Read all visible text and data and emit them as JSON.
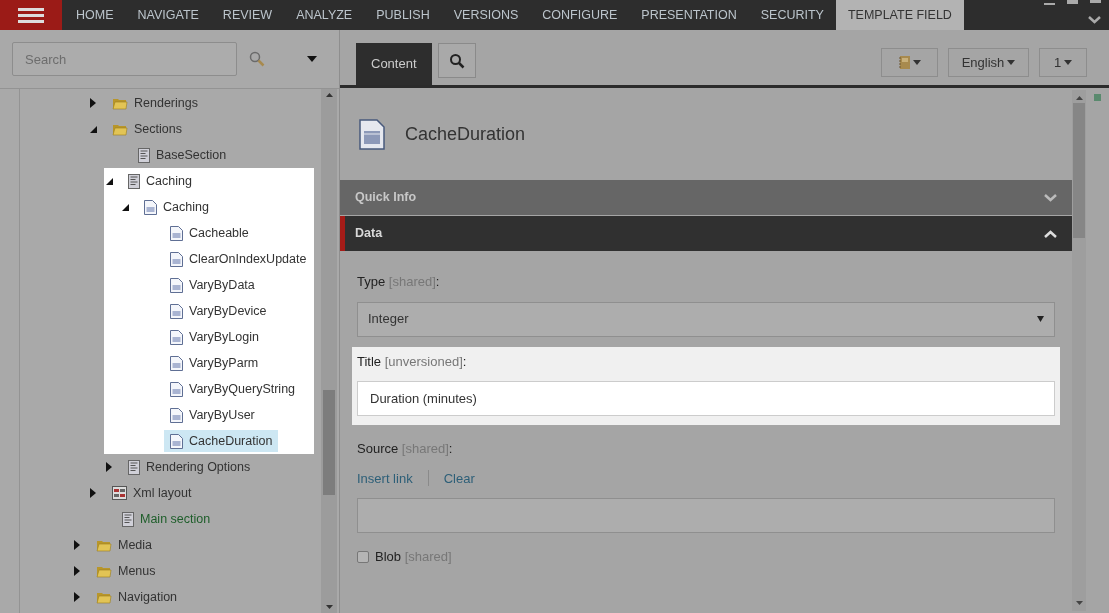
{
  "ribbon": {
    "tabs": [
      {
        "label": "HOME",
        "selected": false
      },
      {
        "label": "NAVIGATE",
        "selected": false
      },
      {
        "label": "REVIEW",
        "selected": false
      },
      {
        "label": "ANALYZE",
        "selected": false
      },
      {
        "label": "PUBLISH",
        "selected": false
      },
      {
        "label": "VERSIONS",
        "selected": false
      },
      {
        "label": "CONFIGURE",
        "selected": false
      },
      {
        "label": "PRESENTATION",
        "selected": false
      },
      {
        "label": "SECURITY",
        "selected": false
      },
      {
        "label": "TEMPLATE FIELD",
        "selected": true
      }
    ]
  },
  "search": {
    "placeholder": "Search"
  },
  "tree": {
    "scrolled_branch": [
      {
        "label": "Renderings",
        "kind": "folder",
        "expanded": false,
        "selected": false
      },
      {
        "label": "Sections",
        "kind": "folder",
        "expanded": true,
        "selected": false,
        "children": [
          {
            "label": "BaseSection",
            "kind": "section",
            "selected": false
          },
          {
            "label": "Caching",
            "kind": "section",
            "expanded": true,
            "selected": false,
            "spotlight": true,
            "children": [
              {
                "label": "Caching",
                "kind": "field",
                "expanded": true,
                "selected": false,
                "children": [
                  {
                    "label": "Cacheable",
                    "kind": "field",
                    "selected": false
                  },
                  {
                    "label": "ClearOnIndexUpdate",
                    "kind": "field",
                    "selected": false
                  },
                  {
                    "label": "VaryByData",
                    "kind": "field",
                    "selected": false
                  },
                  {
                    "label": "VaryByDevice",
                    "kind": "field",
                    "selected": false
                  },
                  {
                    "label": "VaryByLogin",
                    "kind": "field",
                    "selected": false
                  },
                  {
                    "label": "VaryByParm",
                    "kind": "field",
                    "selected": false
                  },
                  {
                    "label": "VaryByQueryString",
                    "kind": "field",
                    "selected": false
                  },
                  {
                    "label": "VaryByUser",
                    "kind": "field",
                    "selected": false
                  },
                  {
                    "label": "CacheDuration",
                    "kind": "field",
                    "selected": true
                  }
                ]
              }
            ]
          },
          {
            "label": "Rendering Options",
            "kind": "section",
            "expanded": false,
            "selected": false
          }
        ]
      },
      {
        "label": "Xml layout",
        "kind": "layout",
        "expanded": false,
        "selected": false
      },
      {
        "label": "Main section",
        "kind": "section",
        "selected": false,
        "color": "#1e5e2a"
      }
    ],
    "items": [
      {
        "label": "Media",
        "kind": "folder",
        "expanded": false,
        "selected": false
      },
      {
        "label": "Menus",
        "kind": "folder",
        "expanded": false,
        "selected": false
      },
      {
        "label": "Navigation",
        "kind": "folder",
        "expanded": false,
        "selected": false
      }
    ]
  },
  "editor_tabs": [
    {
      "label": "Content",
      "selected": true
    }
  ],
  "toolbar_buttons": [
    {
      "kind": "icon"
    },
    {
      "kind": "text",
      "label": "English"
    },
    {
      "kind": "text",
      "label": "1"
    }
  ],
  "item": {
    "title": "CacheDuration"
  },
  "sections": [
    {
      "title": "Quick Info",
      "expanded": false
    },
    {
      "title": "Data",
      "expanded": true
    }
  ],
  "fields": [
    {
      "kind": "select",
      "label": "Type",
      "qualifier": "[shared]",
      "punctuation": ":",
      "value": "Integer"
    },
    {
      "kind": "text",
      "label": "Title",
      "qualifier": "[unversioned]",
      "punctuation": ":",
      "value": "Duration (minutes)",
      "spotlight": true
    },
    {
      "kind": "link",
      "label": "Source",
      "qualifier": "[shared]",
      "punctuation": ":",
      "actions": [
        "Insert link",
        "Clear"
      ]
    },
    {
      "kind": "checkbox",
      "label": "Blob",
      "qualifier": "[shared]",
      "checked": false
    }
  ]
}
